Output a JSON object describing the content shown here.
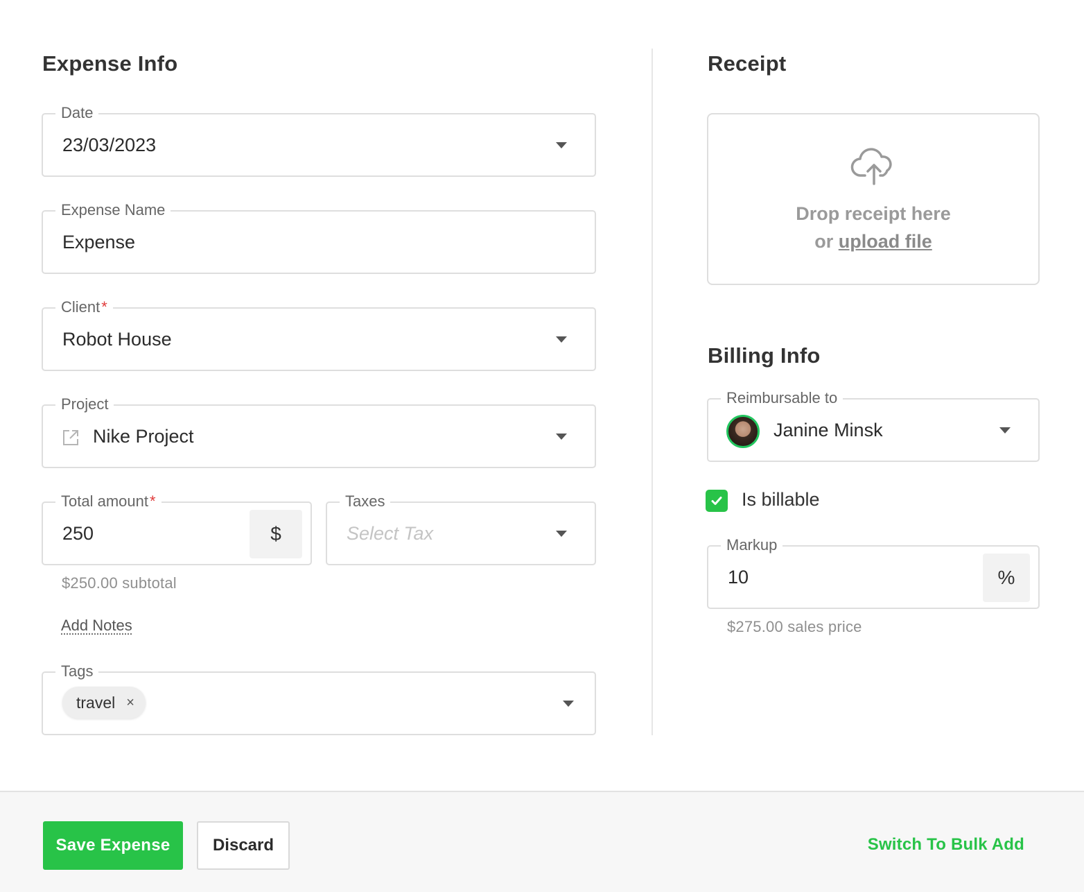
{
  "expense_info": {
    "title": "Expense Info",
    "date": {
      "label": "Date",
      "value": "23/03/2023"
    },
    "expense_name": {
      "label": "Expense Name",
      "value": "Expense"
    },
    "client": {
      "label": "Client",
      "required_mark": "*",
      "value": "Robot House"
    },
    "project": {
      "label": "Project",
      "value": "Nike Project"
    },
    "total_amount": {
      "label": "Total amount",
      "required_mark": "*",
      "value": "250",
      "currency": "$",
      "helper": "$250.00 subtotal"
    },
    "taxes": {
      "label": "Taxes",
      "placeholder": "Select Tax"
    },
    "add_notes": "Add Notes",
    "tags": {
      "label": "Tags",
      "items": [
        {
          "label": "travel",
          "remove": "×"
        }
      ]
    }
  },
  "receipt": {
    "title": "Receipt",
    "drop_text": "Drop receipt here",
    "or_text": "or",
    "upload_link": "upload file"
  },
  "billing_info": {
    "title": "Billing Info",
    "reimbursable_to": {
      "label": "Reimbursable to",
      "value": "Janine Minsk"
    },
    "is_billable": {
      "label": "Is billable",
      "checked": true
    },
    "markup": {
      "label": "Markup",
      "value": "10",
      "unit": "%",
      "helper": "$275.00 sales price"
    }
  },
  "footer": {
    "save_label": "Save Expense",
    "discard_label": "Discard",
    "bulk_add_label": "Switch To Bulk Add"
  },
  "colors": {
    "accent": "#28c348",
    "required": "#e03b3b",
    "border": "#dedede"
  },
  "icons": {
    "dropdown": "caret-down-icon",
    "project": "external-link-icon",
    "upload": "cloud-upload-icon",
    "check": "check-icon",
    "remove": "close-icon"
  }
}
